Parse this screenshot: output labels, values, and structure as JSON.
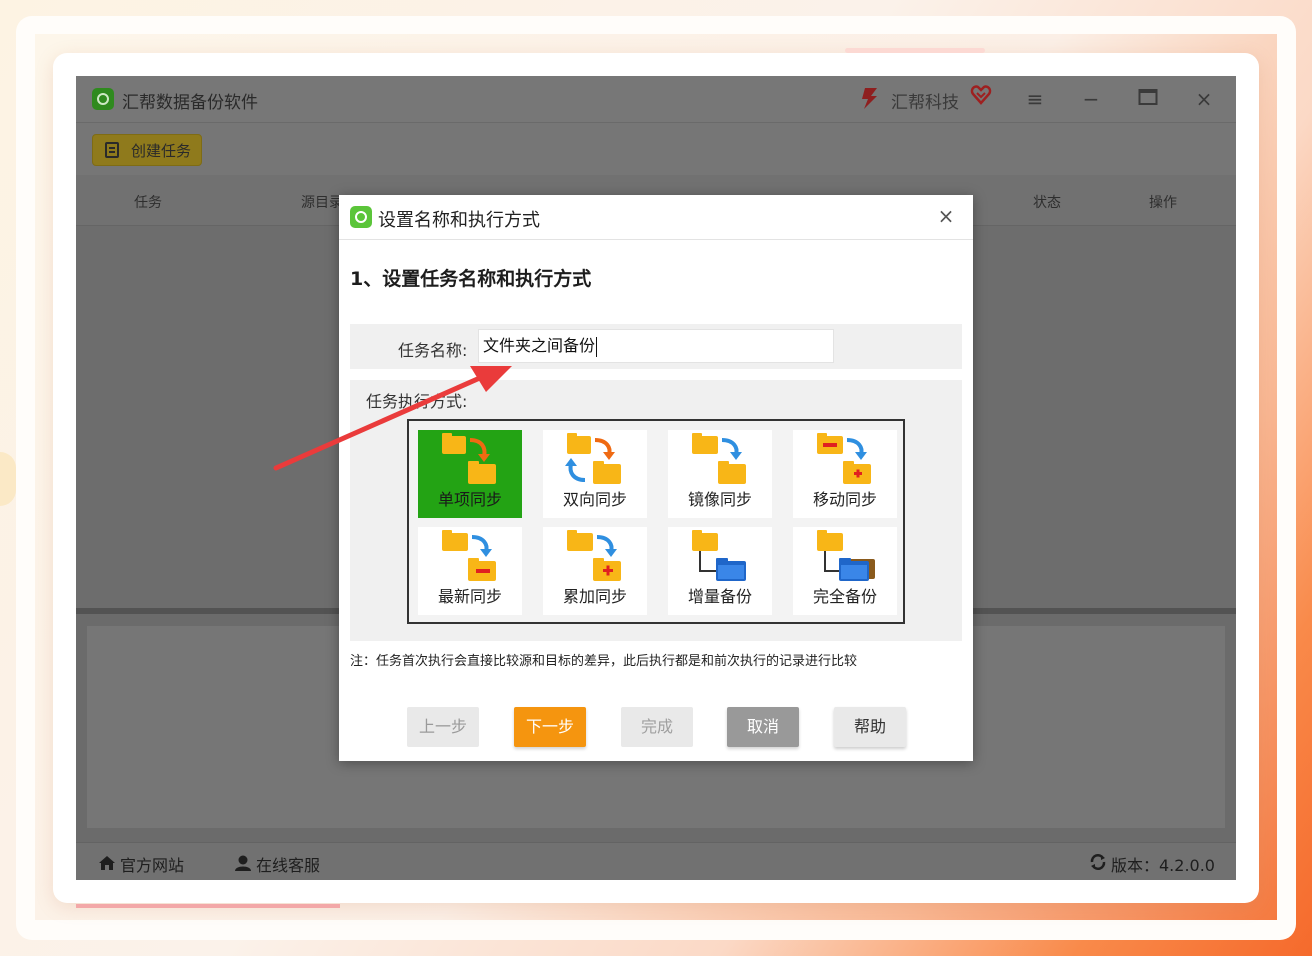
{
  "app": {
    "title": "汇帮数据备份软件",
    "brand_name": "汇帮科技",
    "create_task_label": "创建任务"
  },
  "table": {
    "columns": [
      "任务",
      "源目录",
      "状态",
      "操作"
    ]
  },
  "footer": {
    "official_site": "官方网站",
    "online_service": "在线客服",
    "version": "版本：4.2.0.0"
  },
  "dialog": {
    "title": "设置名称和执行方式",
    "heading": "1、设置任务名称和执行方式",
    "task_name_label": "任务名称:",
    "task_name_value": "文件夹之间备份",
    "mode_label": "任务执行方式:",
    "modes": [
      {
        "label": "单项同步",
        "selected": true
      },
      {
        "label": "双向同步",
        "selected": false
      },
      {
        "label": "镜像同步",
        "selected": false
      },
      {
        "label": "移动同步",
        "selected": false
      },
      {
        "label": "最新同步",
        "selected": false
      },
      {
        "label": "累加同步",
        "selected": false
      },
      {
        "label": "增量备份",
        "selected": false
      },
      {
        "label": "完全备份",
        "selected": false
      }
    ],
    "note": "注：任务首次执行会直接比较源和目标的差异，此后执行都是和前次执行的记录进行比较",
    "buttons": {
      "prev": "上一步",
      "next": "下一步",
      "finish": "完成",
      "cancel": "取消",
      "help": "帮助"
    }
  },
  "colors": {
    "accent_orange": "#f5950f",
    "selected_green": "#23a314",
    "folder_yellow": "#f8b617",
    "arrow_red": "#ea3b3b"
  }
}
